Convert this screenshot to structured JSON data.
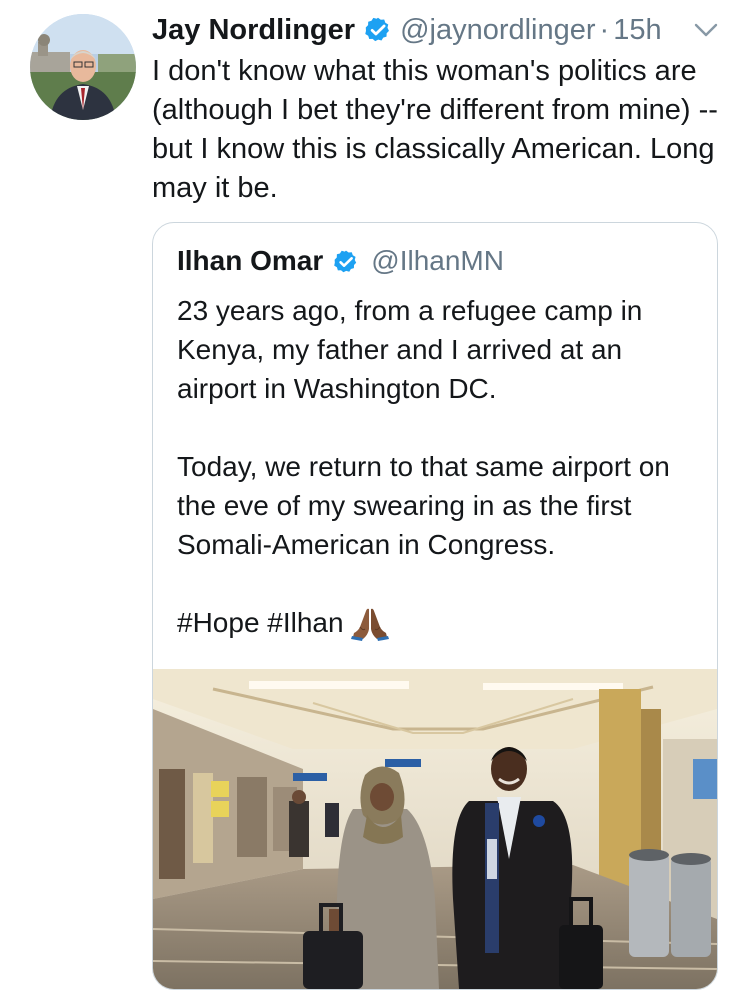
{
  "tweet": {
    "display_name": "Jay Nordlinger",
    "handle": "@jaynordlinger",
    "separator": "·",
    "time": "15h",
    "text": "I don't know what this woman's politics are (although I bet they're different from mine) -- but I know this is classically American. Long may it be."
  },
  "quoted_tweet": {
    "display_name": "Ilhan Omar",
    "handle": "@IlhanMN",
    "paragraph_1": "23 years ago, from a refugee camp in Kenya, my father and I arrived at an airport in Washington DC.",
    "paragraph_2": "Today, we return to that same airport on the eve of my swearing in as the first Somali-American in Congress.",
    "hashtags": "#Hope #Ilhan",
    "emoji_icon": "folded-hands-icon"
  },
  "colors": {
    "verified_blue": "#1da1f2",
    "secondary_text": "#657786",
    "border": "#ccd6dd"
  }
}
